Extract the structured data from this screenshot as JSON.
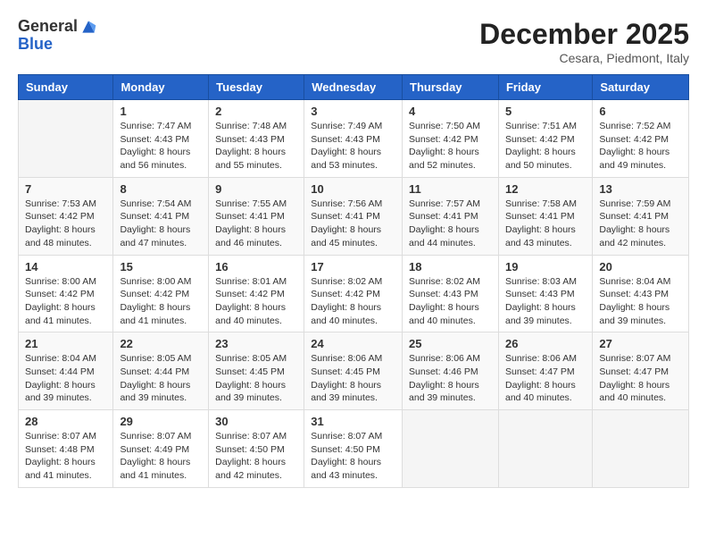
{
  "logo": {
    "general": "General",
    "blue": "Blue"
  },
  "header": {
    "month": "December 2025",
    "location": "Cesara, Piedmont, Italy"
  },
  "weekdays": [
    "Sunday",
    "Monday",
    "Tuesday",
    "Wednesday",
    "Thursday",
    "Friday",
    "Saturday"
  ],
  "weeks": [
    [
      {
        "day": "",
        "sunrise": "",
        "sunset": "",
        "daylight": ""
      },
      {
        "day": "1",
        "sunrise": "Sunrise: 7:47 AM",
        "sunset": "Sunset: 4:43 PM",
        "daylight": "Daylight: 8 hours and 56 minutes."
      },
      {
        "day": "2",
        "sunrise": "Sunrise: 7:48 AM",
        "sunset": "Sunset: 4:43 PM",
        "daylight": "Daylight: 8 hours and 55 minutes."
      },
      {
        "day": "3",
        "sunrise": "Sunrise: 7:49 AM",
        "sunset": "Sunset: 4:43 PM",
        "daylight": "Daylight: 8 hours and 53 minutes."
      },
      {
        "day": "4",
        "sunrise": "Sunrise: 7:50 AM",
        "sunset": "Sunset: 4:42 PM",
        "daylight": "Daylight: 8 hours and 52 minutes."
      },
      {
        "day": "5",
        "sunrise": "Sunrise: 7:51 AM",
        "sunset": "Sunset: 4:42 PM",
        "daylight": "Daylight: 8 hours and 50 minutes."
      },
      {
        "day": "6",
        "sunrise": "Sunrise: 7:52 AM",
        "sunset": "Sunset: 4:42 PM",
        "daylight": "Daylight: 8 hours and 49 minutes."
      }
    ],
    [
      {
        "day": "7",
        "sunrise": "Sunrise: 7:53 AM",
        "sunset": "Sunset: 4:42 PM",
        "daylight": "Daylight: 8 hours and 48 minutes."
      },
      {
        "day": "8",
        "sunrise": "Sunrise: 7:54 AM",
        "sunset": "Sunset: 4:41 PM",
        "daylight": "Daylight: 8 hours and 47 minutes."
      },
      {
        "day": "9",
        "sunrise": "Sunrise: 7:55 AM",
        "sunset": "Sunset: 4:41 PM",
        "daylight": "Daylight: 8 hours and 46 minutes."
      },
      {
        "day": "10",
        "sunrise": "Sunrise: 7:56 AM",
        "sunset": "Sunset: 4:41 PM",
        "daylight": "Daylight: 8 hours and 45 minutes."
      },
      {
        "day": "11",
        "sunrise": "Sunrise: 7:57 AM",
        "sunset": "Sunset: 4:41 PM",
        "daylight": "Daylight: 8 hours and 44 minutes."
      },
      {
        "day": "12",
        "sunrise": "Sunrise: 7:58 AM",
        "sunset": "Sunset: 4:41 PM",
        "daylight": "Daylight: 8 hours and 43 minutes."
      },
      {
        "day": "13",
        "sunrise": "Sunrise: 7:59 AM",
        "sunset": "Sunset: 4:41 PM",
        "daylight": "Daylight: 8 hours and 42 minutes."
      }
    ],
    [
      {
        "day": "14",
        "sunrise": "Sunrise: 8:00 AM",
        "sunset": "Sunset: 4:42 PM",
        "daylight": "Daylight: 8 hours and 41 minutes."
      },
      {
        "day": "15",
        "sunrise": "Sunrise: 8:00 AM",
        "sunset": "Sunset: 4:42 PM",
        "daylight": "Daylight: 8 hours and 41 minutes."
      },
      {
        "day": "16",
        "sunrise": "Sunrise: 8:01 AM",
        "sunset": "Sunset: 4:42 PM",
        "daylight": "Daylight: 8 hours and 40 minutes."
      },
      {
        "day": "17",
        "sunrise": "Sunrise: 8:02 AM",
        "sunset": "Sunset: 4:42 PM",
        "daylight": "Daylight: 8 hours and 40 minutes."
      },
      {
        "day": "18",
        "sunrise": "Sunrise: 8:02 AM",
        "sunset": "Sunset: 4:43 PM",
        "daylight": "Daylight: 8 hours and 40 minutes."
      },
      {
        "day": "19",
        "sunrise": "Sunrise: 8:03 AM",
        "sunset": "Sunset: 4:43 PM",
        "daylight": "Daylight: 8 hours and 39 minutes."
      },
      {
        "day": "20",
        "sunrise": "Sunrise: 8:04 AM",
        "sunset": "Sunset: 4:43 PM",
        "daylight": "Daylight: 8 hours and 39 minutes."
      }
    ],
    [
      {
        "day": "21",
        "sunrise": "Sunrise: 8:04 AM",
        "sunset": "Sunset: 4:44 PM",
        "daylight": "Daylight: 8 hours and 39 minutes."
      },
      {
        "day": "22",
        "sunrise": "Sunrise: 8:05 AM",
        "sunset": "Sunset: 4:44 PM",
        "daylight": "Daylight: 8 hours and 39 minutes."
      },
      {
        "day": "23",
        "sunrise": "Sunrise: 8:05 AM",
        "sunset": "Sunset: 4:45 PM",
        "daylight": "Daylight: 8 hours and 39 minutes."
      },
      {
        "day": "24",
        "sunrise": "Sunrise: 8:06 AM",
        "sunset": "Sunset: 4:45 PM",
        "daylight": "Daylight: 8 hours and 39 minutes."
      },
      {
        "day": "25",
        "sunrise": "Sunrise: 8:06 AM",
        "sunset": "Sunset: 4:46 PM",
        "daylight": "Daylight: 8 hours and 39 minutes."
      },
      {
        "day": "26",
        "sunrise": "Sunrise: 8:06 AM",
        "sunset": "Sunset: 4:47 PM",
        "daylight": "Daylight: 8 hours and 40 minutes."
      },
      {
        "day": "27",
        "sunrise": "Sunrise: 8:07 AM",
        "sunset": "Sunset: 4:47 PM",
        "daylight": "Daylight: 8 hours and 40 minutes."
      }
    ],
    [
      {
        "day": "28",
        "sunrise": "Sunrise: 8:07 AM",
        "sunset": "Sunset: 4:48 PM",
        "daylight": "Daylight: 8 hours and 41 minutes."
      },
      {
        "day": "29",
        "sunrise": "Sunrise: 8:07 AM",
        "sunset": "Sunset: 4:49 PM",
        "daylight": "Daylight: 8 hours and 41 minutes."
      },
      {
        "day": "30",
        "sunrise": "Sunrise: 8:07 AM",
        "sunset": "Sunset: 4:50 PM",
        "daylight": "Daylight: 8 hours and 42 minutes."
      },
      {
        "day": "31",
        "sunrise": "Sunrise: 8:07 AM",
        "sunset": "Sunset: 4:50 PM",
        "daylight": "Daylight: 8 hours and 43 minutes."
      },
      {
        "day": "",
        "sunrise": "",
        "sunset": "",
        "daylight": ""
      },
      {
        "day": "",
        "sunrise": "",
        "sunset": "",
        "daylight": ""
      },
      {
        "day": "",
        "sunrise": "",
        "sunset": "",
        "daylight": ""
      }
    ]
  ]
}
